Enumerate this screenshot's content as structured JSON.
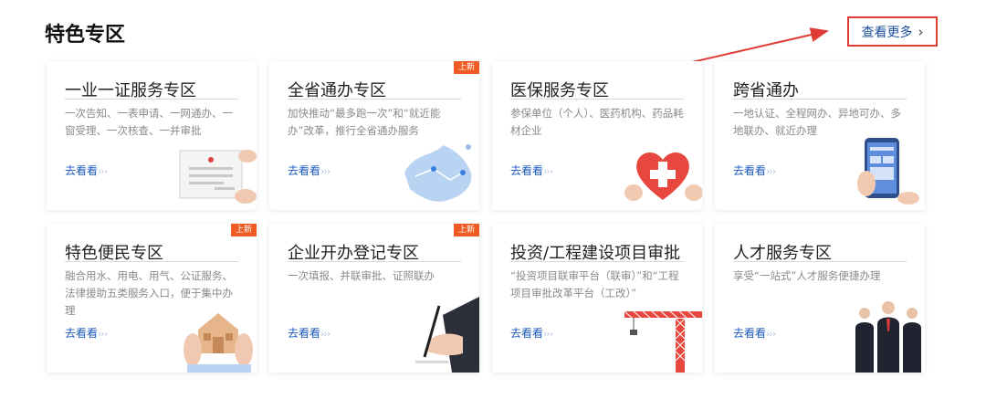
{
  "section": {
    "title": "特色专区",
    "more_label": "查看更多",
    "more_chevron": "›"
  },
  "cards": [
    {
      "title": "一业一证服务专区",
      "desc": "一次告知、一表申请、一网通办、一窗受理、一次核查、一并审批",
      "link": "去看看",
      "badge": ""
    },
    {
      "title": "全省通办专区",
      "desc": "加快推动“最多跑一次”和“就近能办”改革，推行全省通办服务",
      "link": "去看看",
      "badge": "上新"
    },
    {
      "title": "医保服务专区",
      "desc": "参保单位（个人）、医药机构、药品耗材企业",
      "link": "去看看",
      "badge": ""
    },
    {
      "title": "跨省通办",
      "desc": "一地认证、全程网办、异地可办、多地联办、就近办理",
      "link": "去看看",
      "badge": ""
    },
    {
      "title": "特色便民专区",
      "desc": "融合用水、用电、用气、公证服务、法律援助五类服务入口，便于集中办理",
      "link": "去看看",
      "badge": "上新"
    },
    {
      "title": "企业开办登记专区",
      "desc": "一次填报、并联审批、证照联办",
      "link": "去看看",
      "badge": "上新"
    },
    {
      "title": "投资/工程建设项目审批",
      "desc": "“投资项目联审平台（联审）”和“工程项目审批改革平台（工改）”",
      "link": "去看看",
      "badge": ""
    },
    {
      "title": "人才服务专区",
      "desc": "享受“一站式”人才服务便捷办理",
      "link": "去看看",
      "badge": ""
    }
  ],
  "link_suffix": "›››",
  "colors": {
    "accent_red": "#e03c35",
    "link_blue": "#1d5bbf",
    "badge_orange": "#f05a23"
  }
}
